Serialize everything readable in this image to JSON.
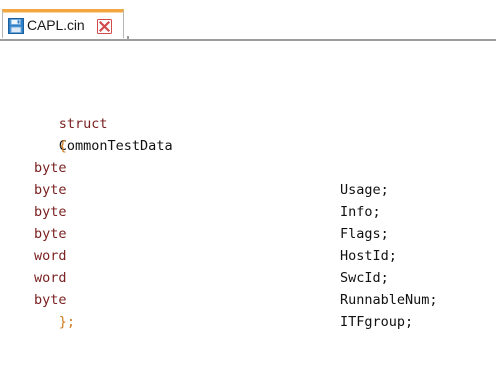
{
  "tab": {
    "label": "CAPL.cin",
    "save_icon": "save-icon",
    "close_icon": "close-icon"
  },
  "editor": {
    "struct_keyword": "struct",
    "struct_name": "CommonTestData",
    "open_brace": "{",
    "close_brace": "};",
    "fields": [
      {
        "type": "byte",
        "name": "Usage;"
      },
      {
        "type": "byte",
        "name": "Info;"
      },
      {
        "type": "byte",
        "name": "Flags;"
      },
      {
        "type": "byte",
        "name": "HostId;"
      },
      {
        "type": "word",
        "name": "SwcId;"
      },
      {
        "type": "word",
        "name": "RunnableNum;"
      },
      {
        "type": "byte",
        "name": "ITFgroup;"
      }
    ]
  },
  "colors": {
    "tab_accent": "#f2a742",
    "keyword": "#7a1f1f",
    "brace": "#cc7a1b",
    "text": "#111111",
    "close_icon": "#d24b4b"
  }
}
